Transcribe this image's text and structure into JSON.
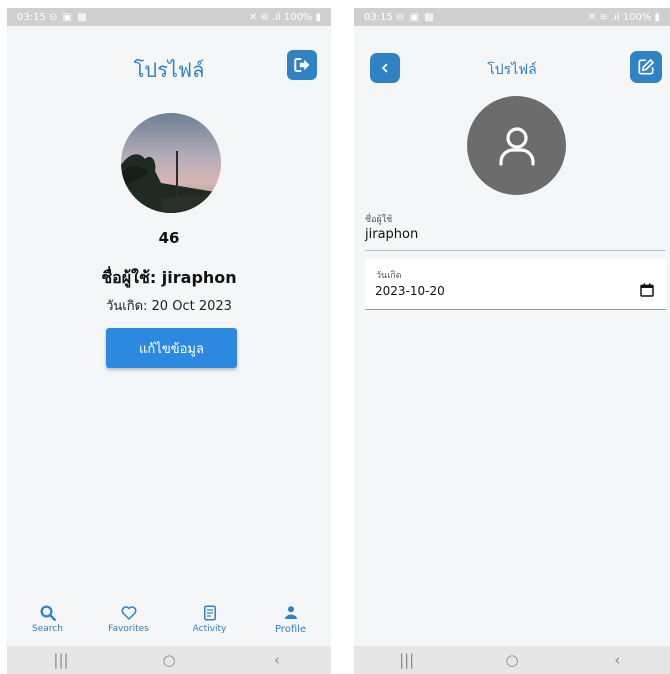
{
  "left_screen": {
    "status_time": "03:15",
    "status_battery": "100%",
    "title": "โปรไฟล์",
    "count": "46",
    "username_line": "ชื่อผู้ใช้: jiraphon",
    "birth_line": "วันเกิด: 20 Oct 2023",
    "edit_button": "แก้ไขข้อมูล",
    "tabs": [
      {
        "label": "Search",
        "icon": "search-icon"
      },
      {
        "label": "Favorites",
        "icon": "heart-icon"
      },
      {
        "label": "Activity",
        "icon": "document-icon"
      },
      {
        "label": "Profile",
        "icon": "person-icon"
      }
    ],
    "accent": "#2f82c4",
    "button_color": "#2d89e0"
  },
  "right_screen": {
    "status_time": "03:15",
    "status_battery": "100%",
    "title": "โปรไฟล์",
    "username_label": "ชื่อผู้ใช้",
    "username_value": "jiraphon",
    "birth_label": "วันเกิด",
    "birth_value": "2023-10-20"
  }
}
